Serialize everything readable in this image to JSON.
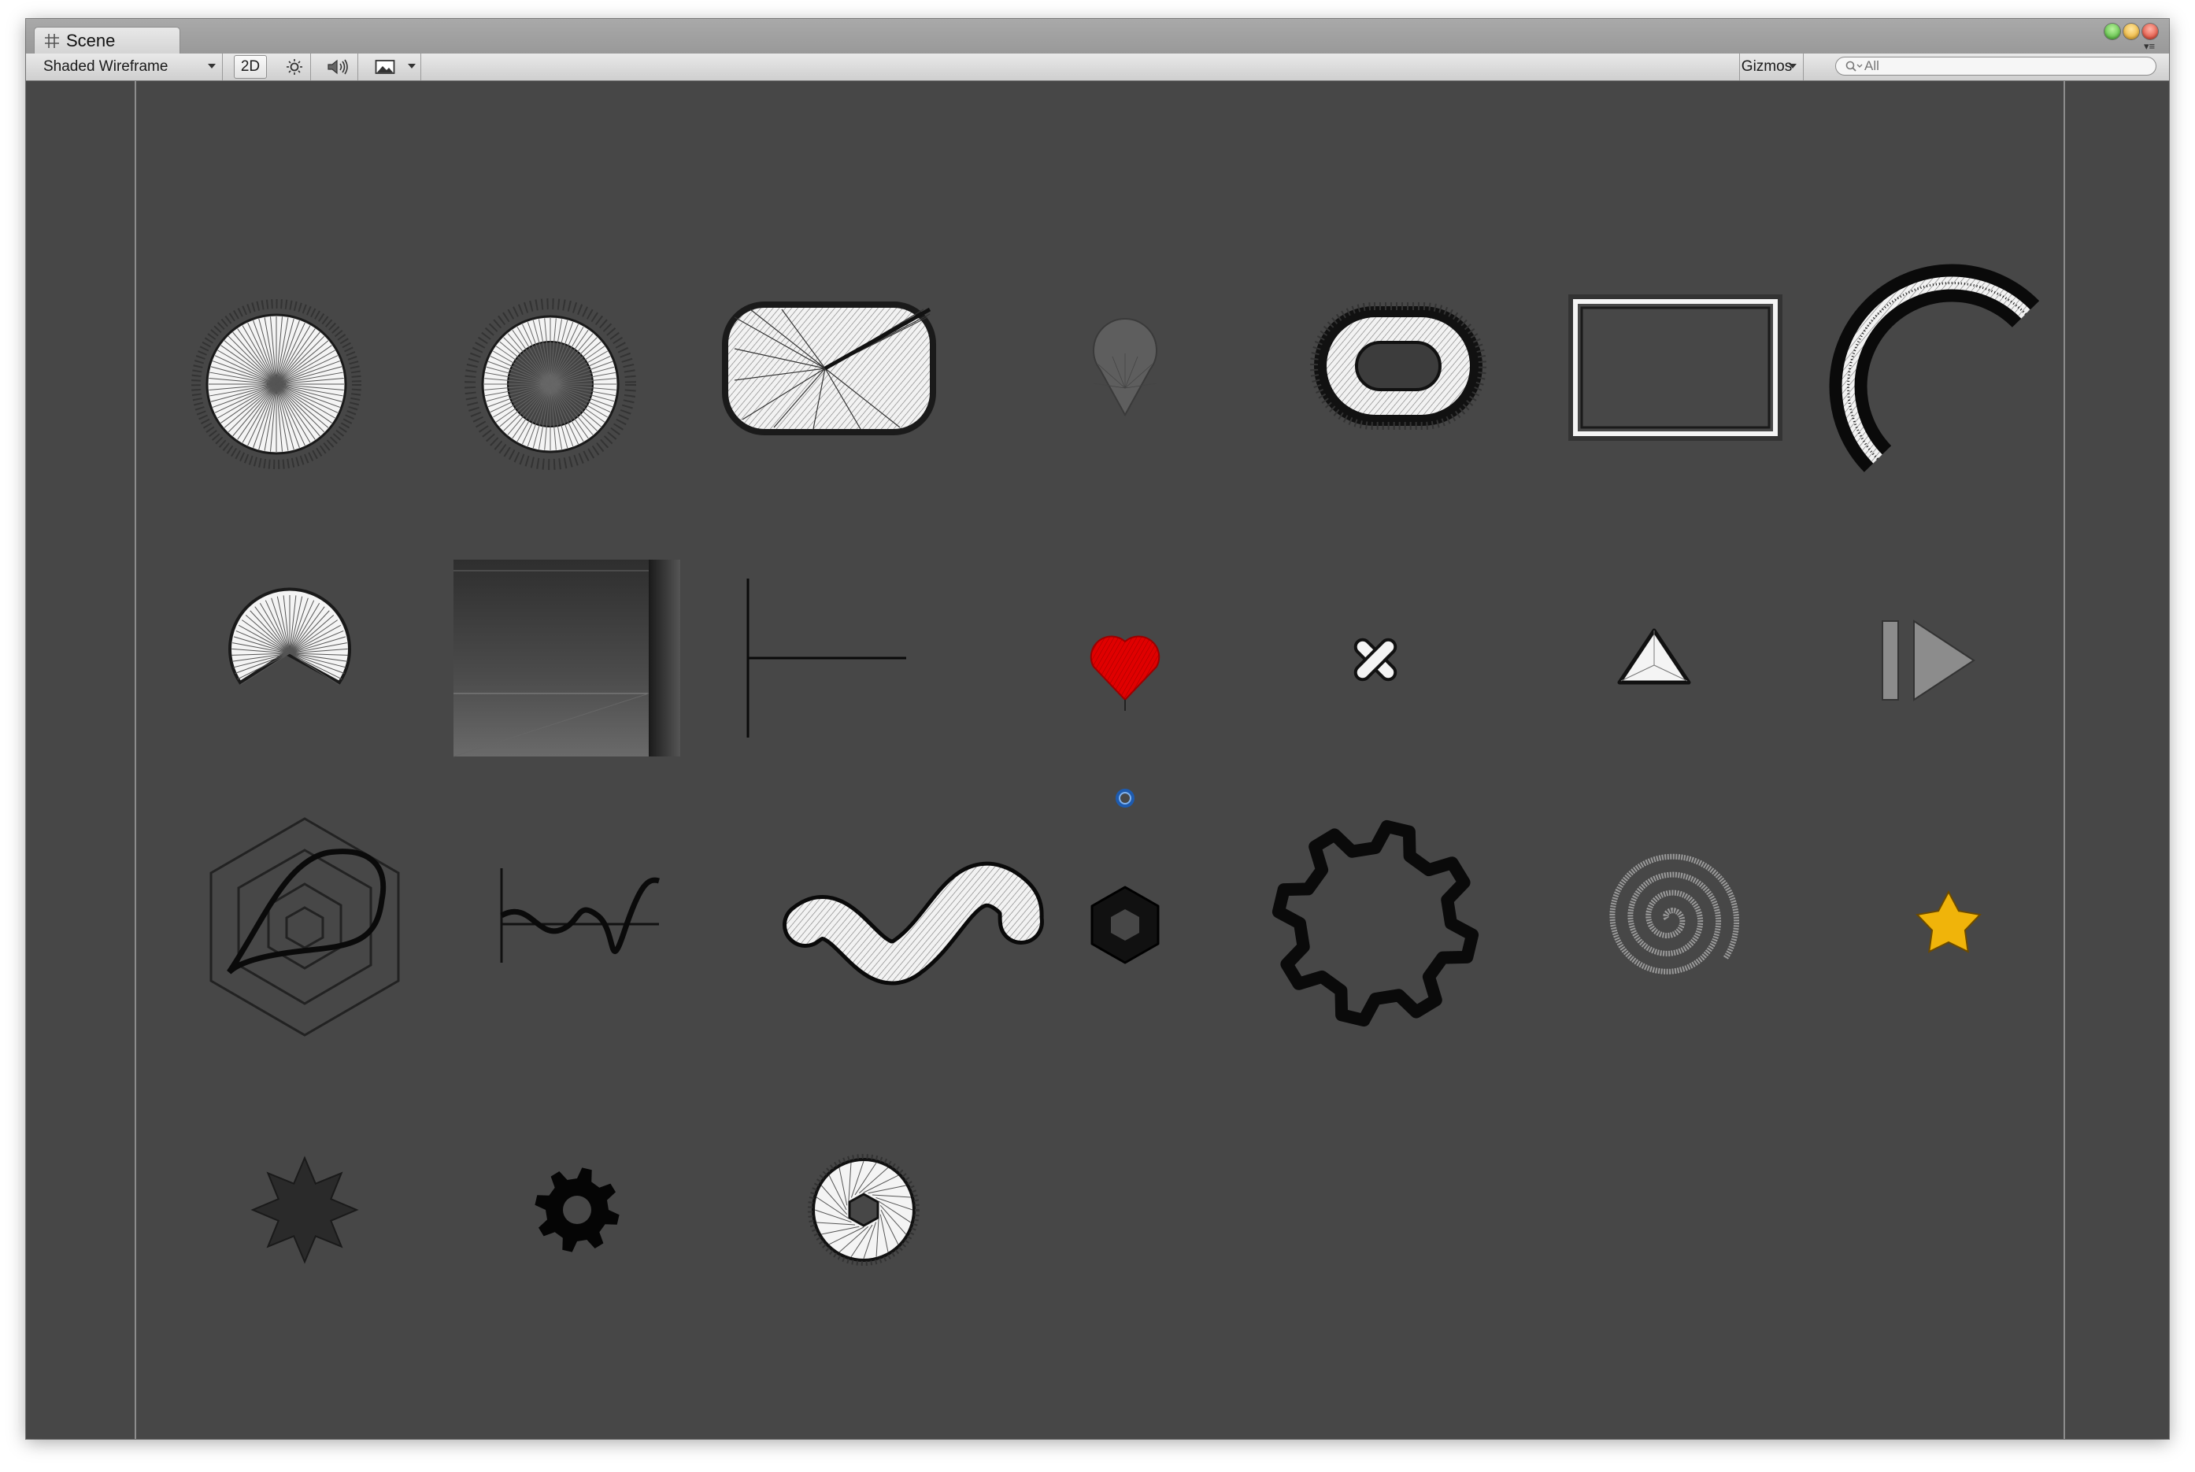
{
  "window": {
    "tab_title": "Scene",
    "tab_icon": "scene-grid-icon"
  },
  "toolbar": {
    "draw_mode": "Shaded Wireframe",
    "mode_2d_label": "2D",
    "lighting_icon": "sun-icon",
    "audio_icon": "speaker-icon",
    "effects_icon": "image-icon",
    "gizmos_label": "Gizmos",
    "search_placeholder": "All"
  },
  "colors": {
    "viewport_bg": "#474747",
    "heart": "#e00000",
    "star": "#f0b40a",
    "pivot": "#4a8fe0"
  }
}
